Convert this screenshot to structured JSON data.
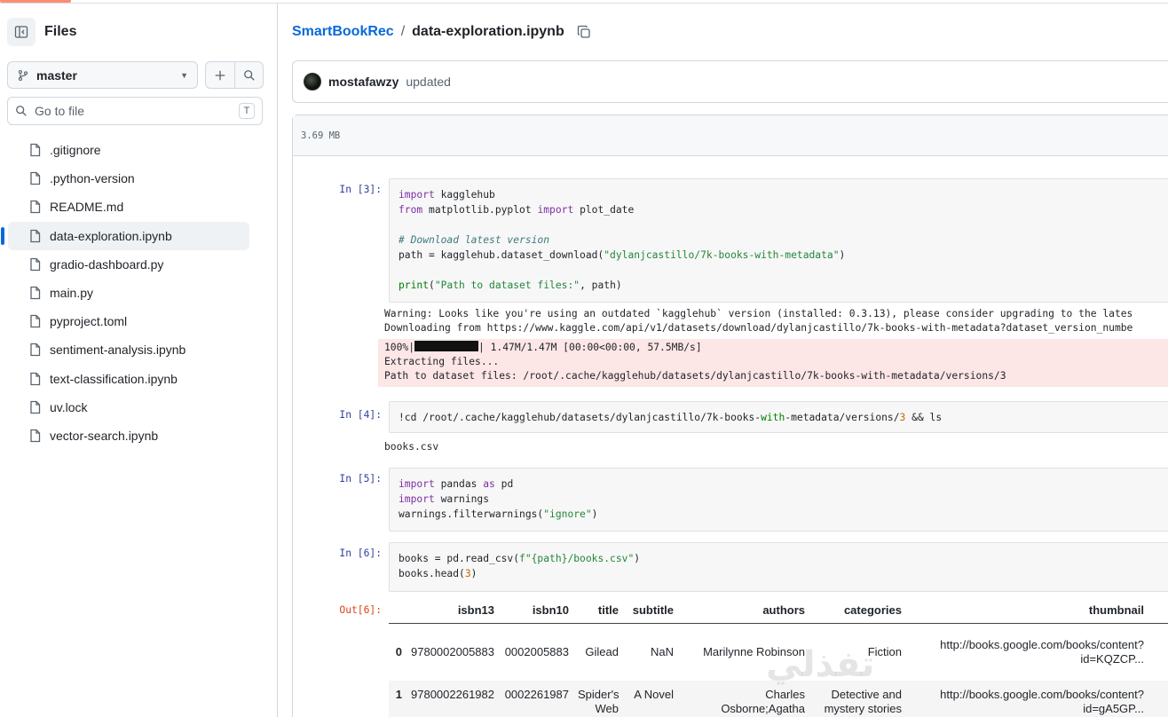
{
  "sidebar": {
    "title": "Files",
    "branch": "master",
    "search_placeholder": "Go to file",
    "search_shortcut": "T",
    "files": [
      {
        "name": ".gitignore",
        "active": false
      },
      {
        "name": ".python-version",
        "active": false
      },
      {
        "name": "README.md",
        "active": false
      },
      {
        "name": "data-exploration.ipynb",
        "active": true
      },
      {
        "name": "gradio-dashboard.py",
        "active": false
      },
      {
        "name": "main.py",
        "active": false
      },
      {
        "name": "pyproject.toml",
        "active": false
      },
      {
        "name": "sentiment-analysis.ipynb",
        "active": false
      },
      {
        "name": "text-classification.ipynb",
        "active": false
      },
      {
        "name": "uv.lock",
        "active": false
      },
      {
        "name": "vector-search.ipynb",
        "active": false
      }
    ]
  },
  "breadcrumb": {
    "repo": "SmartBookRec",
    "separator": "/",
    "file": "data-exploration.ipynb"
  },
  "commit": {
    "user": "mostafawzy",
    "message": "updated"
  },
  "file_info": {
    "size": "3.69 MB"
  },
  "cells": {
    "c3": {
      "prompt": "In [3]:",
      "lines": [
        [
          {
            "t": "import",
            "c": "kw"
          },
          {
            "t": " kagglehub",
            "c": ""
          }
        ],
        [
          {
            "t": "from",
            "c": "kw"
          },
          {
            "t": " matplotlib.pyplot ",
            "c": ""
          },
          {
            "t": "import",
            "c": "kw"
          },
          {
            "t": " plot_date",
            "c": ""
          }
        ],
        [],
        [
          {
            "t": "# Download latest version",
            "c": "cmt"
          }
        ],
        [
          {
            "t": "path = kagglehub.dataset_download(",
            "c": ""
          },
          {
            "t": "\"dylanjcastillo/7k-books-with-metadata\"",
            "c": "str2"
          },
          {
            "t": ")",
            "c": ""
          }
        ],
        [],
        [
          {
            "t": "print",
            "c": "kw2"
          },
          {
            "t": "(",
            "c": ""
          },
          {
            "t": "\"Path to dataset files:\"",
            "c": "str2"
          },
          {
            "t": ", path)",
            "c": ""
          }
        ]
      ],
      "warning": "Warning: Looks like you're using an outdated `kagglehub` version (installed: 0.3.13), please consider upgrading to the lates",
      "downloading": "Downloading from https://www.kaggle.com/api/v1/datasets/download/dylanjcastillo/7k-books-with-metadata?dataset_version_numbe",
      "progress_pct": "100%|",
      "progress_rest": "| 1.47M/1.47M [00:00<00:00, 57.5MB/s]",
      "extracting": "Extracting files...",
      "path_out": "Path to dataset files: /root/.cache/kagglehub/datasets/dylanjcastillo/7k-books-with-metadata/versions/3"
    },
    "c4": {
      "prompt": "In [4]:",
      "lines": [
        [
          {
            "t": "!cd /root/.cache/kagglehub/datasets/dylanjcastillo/7k-books-",
            "c": ""
          },
          {
            "t": "with",
            "c": "kw2"
          },
          {
            "t": "-metadata/versions/",
            "c": ""
          },
          {
            "t": "3",
            "c": "num"
          },
          {
            "t": " && ls",
            "c": ""
          }
        ]
      ],
      "output": "books.csv"
    },
    "c5": {
      "prompt": "In [5]:",
      "lines": [
        [
          {
            "t": "import",
            "c": "kw"
          },
          {
            "t": " pandas ",
            "c": ""
          },
          {
            "t": "as",
            "c": "kw"
          },
          {
            "t": " pd",
            "c": ""
          }
        ],
        [
          {
            "t": "import",
            "c": "kw"
          },
          {
            "t": " warnings",
            "c": ""
          }
        ],
        [
          {
            "t": "warnings.filterwarnings(",
            "c": ""
          },
          {
            "t": "\"ignore\"",
            "c": "str2"
          },
          {
            "t": ")",
            "c": ""
          }
        ]
      ]
    },
    "c6": {
      "prompt": "In [6]:",
      "out_prompt": "Out[6]:",
      "lines": [
        [
          {
            "t": "books = pd.read_csv(",
            "c": ""
          },
          {
            "t": "f\"{path}/books.csv\"",
            "c": "str2"
          },
          {
            "t": ")",
            "c": ""
          }
        ],
        [
          {
            "t": "books.head(",
            "c": ""
          },
          {
            "t": "3",
            "c": "num"
          },
          {
            "t": ")",
            "c": ""
          }
        ]
      ]
    }
  },
  "table": {
    "columns": [
      "",
      "isbn13",
      "isbn10",
      "title",
      "subtitle",
      "authors",
      "categories",
      "thumbnail"
    ],
    "rows": [
      [
        "0",
        "9780002005883",
        "0002005883",
        "Gilead",
        "NaN",
        "Marilynne Robinson",
        "Fiction",
        "http://books.google.com/books/content?id=KQZCP..."
      ],
      [
        "1",
        "9780002261982",
        "0002261987",
        "Spider's Web",
        "A Novel",
        "Charles Osborne;Agatha",
        "Detective and mystery stories",
        "http://books.google.com/books/content?id=gA5GP..."
      ]
    ]
  },
  "watermark": "تفذلي"
}
